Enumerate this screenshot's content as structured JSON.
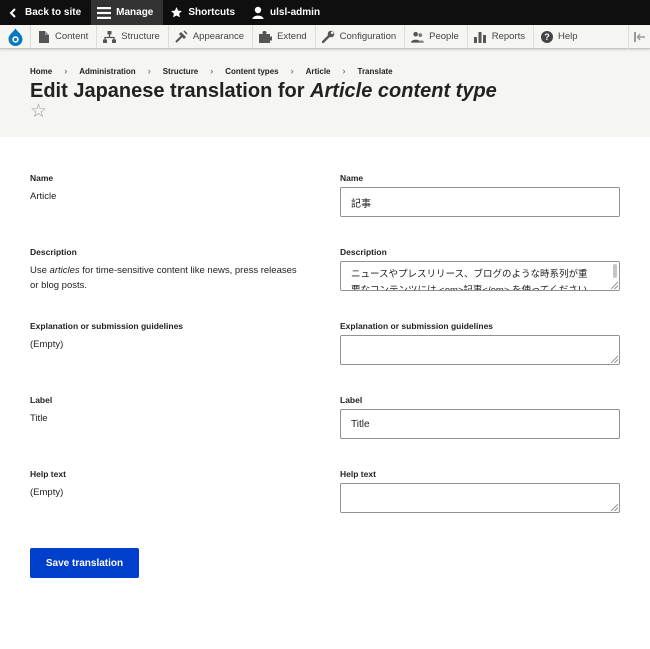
{
  "toolbar": {
    "back_label": "Back to site",
    "manage_label": "Manage",
    "shortcuts_label": "Shortcuts",
    "user_label": "ulsl-admin"
  },
  "tray": {
    "items": [
      {
        "label": "Content",
        "icon": "content-icon"
      },
      {
        "label": "Structure",
        "icon": "structure-icon"
      },
      {
        "label": "Appearance",
        "icon": "appearance-icon"
      },
      {
        "label": "Extend",
        "icon": "extend-icon"
      },
      {
        "label": "Configuration",
        "icon": "wrench-icon"
      },
      {
        "label": "People",
        "icon": "people-icon"
      },
      {
        "label": "Reports",
        "icon": "reports-icon"
      },
      {
        "label": "Help",
        "icon": "help-icon"
      }
    ]
  },
  "breadcrumb": [
    "Home",
    "Administration",
    "Structure",
    "Content types",
    "Article",
    "Translate"
  ],
  "page": {
    "title_prefix": "Edit Japanese translation for ",
    "title_emphasis": "Article content type",
    "star": "☆"
  },
  "fields": {
    "name": {
      "source_label": "Name",
      "source_value": "Article",
      "target_label": "Name",
      "target_value": "記事"
    },
    "description": {
      "source_label": "Description",
      "source_value_pre": "Use ",
      "source_value_em": "articles",
      "source_value_post": " for time-sensitive content like news, press releases or blog posts.",
      "target_label": "Description",
      "target_line1": "ニュースやプレスリリース、ブログのような時系列が重",
      "target_line2": "要なコンテンツには <em>記事</em> を使ってください。"
    },
    "explanation": {
      "source_label": "Explanation or submission guidelines",
      "source_value": "(Empty)",
      "target_label": "Explanation or submission guidelines",
      "target_value": ""
    },
    "label": {
      "source_label": "Label",
      "source_value": "Title",
      "target_label": "Label",
      "target_value": "Title"
    },
    "help": {
      "source_label": "Help text",
      "source_value": "(Empty)",
      "target_label": "Help text",
      "target_value": ""
    }
  },
  "actions": {
    "save_label": "Save translation"
  }
}
